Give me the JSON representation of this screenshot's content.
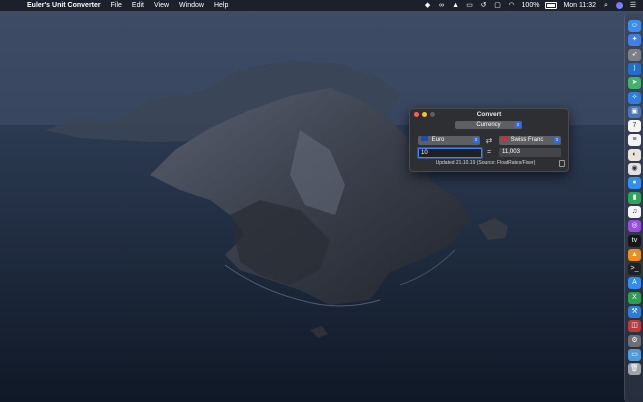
{
  "menubar": {
    "apple_symbol": "",
    "app_name": "Euler's Unit Converter",
    "menus": [
      "File",
      "Edit",
      "View",
      "Window",
      "Help"
    ],
    "battery": "100%",
    "clock": "Mon 11:32"
  },
  "window": {
    "title": "Convert",
    "category": "Currency",
    "from_unit": "Euro",
    "to_unit": "Swiss Franc",
    "swap_symbol": "⇄",
    "input_value": "10",
    "equals": "=",
    "result_value": "11,003",
    "updated_text": "Updated 21.10.19 (Source: FloatRates/Fixer)"
  },
  "dock": {
    "icons": [
      {
        "name": "finder-icon",
        "color": "#3a8ef0",
        "glyph": "☺"
      },
      {
        "name": "safari-icon",
        "color": "#3e7fe8",
        "glyph": "✦"
      },
      {
        "name": "rocket-icon",
        "color": "#7c7f86",
        "glyph": "➶"
      },
      {
        "name": "vscode-icon",
        "color": "#1f6fcf",
        "glyph": "⟩"
      },
      {
        "name": "maps-icon",
        "color": "#3fb36a",
        "glyph": "➤"
      },
      {
        "name": "compass-icon",
        "color": "#2f7de0",
        "glyph": "✧"
      },
      {
        "name": "preview-icon",
        "color": "#4a76b8",
        "glyph": "▣"
      },
      {
        "name": "calendar-icon",
        "color": "#f4f4f4",
        "glyph": "7"
      },
      {
        "name": "notes-icon",
        "color": "#f3f3f3",
        "glyph": "≡"
      },
      {
        "name": "contacts-icon",
        "color": "#e9e4da",
        "glyph": "◐"
      },
      {
        "name": "chrome-icon",
        "color": "#e0e0e0",
        "glyph": "◉"
      },
      {
        "name": "messages-icon",
        "color": "#2d8ef5",
        "glyph": "●"
      },
      {
        "name": "numbers-icon",
        "color": "#2fa35b",
        "glyph": "▮"
      },
      {
        "name": "music-icon",
        "color": "#f4f4f4",
        "glyph": "♫"
      },
      {
        "name": "podcasts-icon",
        "color": "#9a4be0",
        "glyph": "◎"
      },
      {
        "name": "tv-icon",
        "color": "#161616",
        "glyph": "tv"
      },
      {
        "name": "vlc-icon",
        "color": "#ef8c1b",
        "glyph": "▲"
      },
      {
        "name": "terminal-icon",
        "color": "#202020",
        "glyph": ">_"
      },
      {
        "name": "app-store-icon",
        "color": "#2f8cf0",
        "glyph": "A"
      },
      {
        "name": "excel-icon",
        "color": "#2e9e53",
        "glyph": "X"
      },
      {
        "name": "xcode-icon",
        "color": "#2a7dd8",
        "glyph": "⚒"
      },
      {
        "name": "photo-booth-icon",
        "color": "#b83c3c",
        "glyph": "◫"
      },
      {
        "name": "utility-icon",
        "color": "#6c6f75",
        "glyph": "⚙"
      },
      {
        "name": "downloads-folder-icon",
        "color": "#4f9ad8",
        "glyph": "▭"
      },
      {
        "name": "trash-icon",
        "color": "#9ea3aa",
        "glyph": "🗑"
      }
    ]
  }
}
